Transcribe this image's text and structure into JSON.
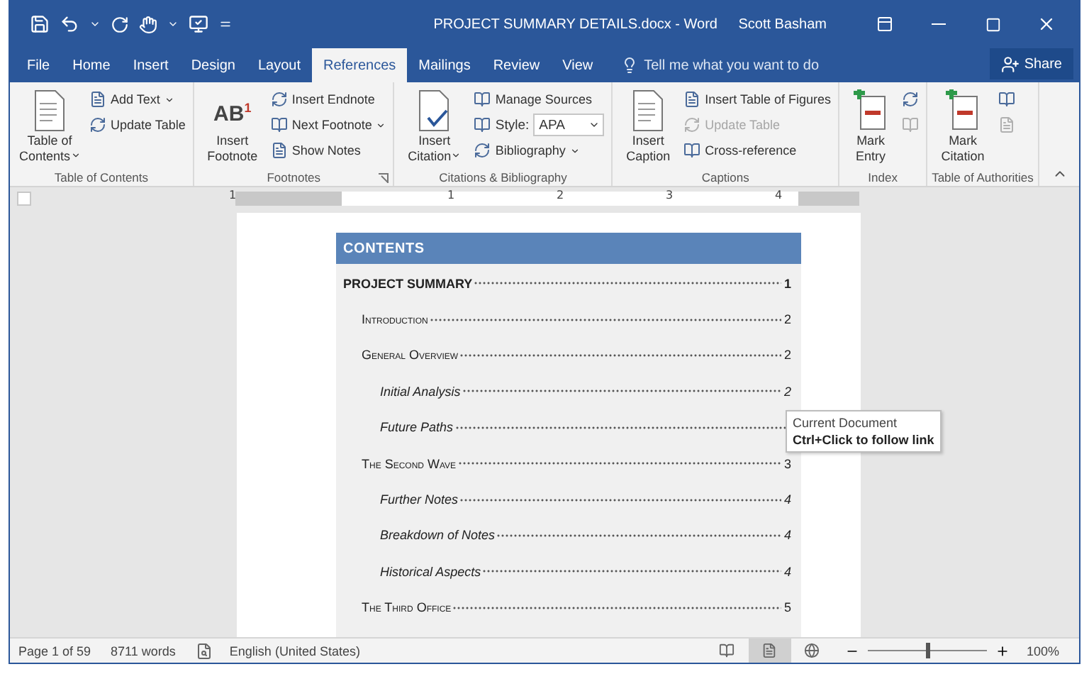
{
  "window": {
    "title": "PROJECT SUMMARY DETAILS.docx - Word",
    "user": "Scott Basham"
  },
  "tabs": [
    {
      "label": "File",
      "selected": false
    },
    {
      "label": "Home",
      "selected": false
    },
    {
      "label": "Insert",
      "selected": false
    },
    {
      "label": "Design",
      "selected": false
    },
    {
      "label": "Layout",
      "selected": false
    },
    {
      "label": "References",
      "selected": true
    },
    {
      "label": "Mailings",
      "selected": false
    },
    {
      "label": "Review",
      "selected": false
    },
    {
      "label": "View",
      "selected": false
    }
  ],
  "tell_me": {
    "placeholder": "Tell me what you want to do"
  },
  "share_button": "Share",
  "ribbon_groups": [
    {
      "label": "Table of Contents",
      "launcher": false,
      "large": {
        "label": "Table of Contents",
        "dropdown": true
      },
      "small": [
        {
          "kind": "button",
          "label": "Add Text",
          "dropdown": true,
          "disabled": false
        },
        {
          "kind": "button",
          "label": "Update Table",
          "dropdown": false,
          "disabled": false
        }
      ]
    },
    {
      "label": "Footnotes",
      "launcher": true,
      "large": {
        "label": "Insert Footnote",
        "dropdown": false,
        "glyph": "AB$^{1}$"
      },
      "small": [
        {
          "kind": "button",
          "label": "Insert Endnote",
          "dropdown": false,
          "disabled": false
        },
        {
          "kind": "button",
          "label": "Next Footnote",
          "dropdown": true,
          "disabled": false
        },
        {
          "kind": "button",
          "label": "Show Notes",
          "dropdown": false,
          "disabled": false
        }
      ]
    },
    {
      "label": "Citations & Bibliography",
      "launcher": false,
      "large": {
        "label": "Insert Citation",
        "dropdown": true
      },
      "small": [
        {
          "kind": "button",
          "label": "Manage Sources",
          "dropdown": false,
          "disabled": false
        },
        {
          "kind": "style",
          "label": "Style:",
          "value": "APA"
        },
        {
          "kind": "button",
          "label": "Bibliography",
          "dropdown": true,
          "disabled": false
        }
      ]
    },
    {
      "label": "Captions",
      "launcher": false,
      "large": {
        "label": "Insert Caption",
        "dropdown": false
      },
      "small": [
        {
          "kind": "button",
          "label": "Insert Table of Figures",
          "dropdown": false,
          "disabled": false
        },
        {
          "kind": "button",
          "label": "Update Table",
          "dropdown": false,
          "disabled": true
        },
        {
          "kind": "button",
          "label": "Cross-reference",
          "dropdown": false,
          "disabled": false
        }
      ]
    },
    {
      "label": "Index",
      "launcher": false,
      "large": {
        "label": "Mark Entry",
        "dropdown": false
      },
      "small": [
        {
          "kind": "icon",
          "disabled": false
        },
        {
          "kind": "icon",
          "disabled": true
        }
      ]
    },
    {
      "label": "Table of Authorities",
      "launcher": false,
      "large": {
        "label": "Mark Citation",
        "dropdown": false
      },
      "small": [
        {
          "kind": "icon",
          "disabled": false
        },
        {
          "kind": "icon",
          "disabled": true
        }
      ]
    }
  ],
  "ruler": {
    "labels": [
      "1",
      "1",
      "2",
      "3",
      "4"
    ]
  },
  "document": {
    "heading": "CONTENTS",
    "toc": [
      {
        "title": "PROJECT SUMMARY",
        "page": "1",
        "children": [
          {
            "title": "Introduction",
            "page": "2"
          },
          {
            "title": "General Overview",
            "page": "2",
            "children": [
              {
                "title": "Initial Analysis",
                "page": "2"
              },
              {
                "title": "Future Paths"
              }
            ]
          },
          {
            "title": "The Second Wave",
            "page": "3",
            "children": [
              {
                "title": "Further Notes",
                "page": "4"
              },
              {
                "title": "Breakdown of Notes",
                "page": "4"
              },
              {
                "title": "Historical Aspects",
                "page": "4"
              }
            ]
          },
          {
            "title": "The Third Office",
            "page": "5"
          }
        ]
      }
    ]
  },
  "tooltip": {
    "title": "Current Document",
    "hint": "Ctrl+Click to follow link"
  },
  "status_bar": {
    "page": "Page 1 of 59",
    "words": "8711 words",
    "language": "English (United States)",
    "views": [
      {
        "selected": false
      },
      {
        "selected": true
      },
      {
        "selected": false
      }
    ],
    "zoom": {
      "level": 0.5,
      "reading": "100%"
    }
  }
}
